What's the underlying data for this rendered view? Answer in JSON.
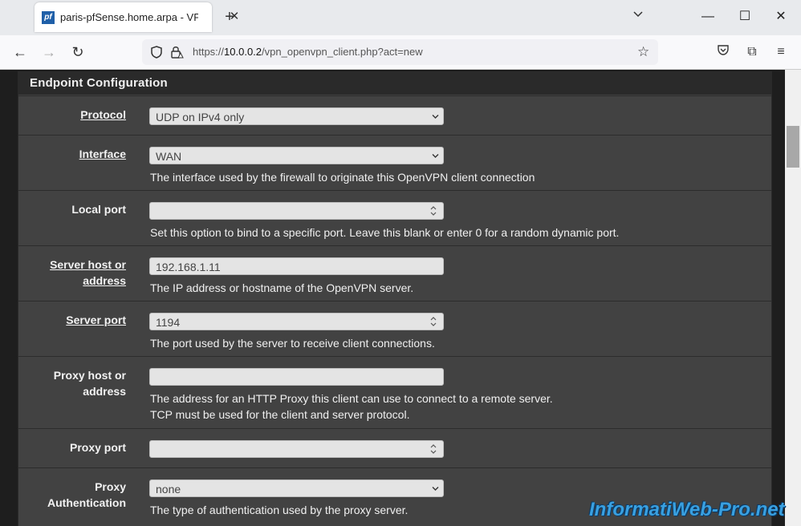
{
  "browser": {
    "tab_title": "paris-pfSense.home.arpa - VPN: OpenVPN: Clients",
    "favicon_text": "pf",
    "url_prefix": "https://",
    "url_host": "10.0.0.2",
    "url_path": "/vpn_openvpn_client.php?act=new"
  },
  "panel": {
    "title": "Endpoint Configuration"
  },
  "fields": {
    "protocol": {
      "label": "Protocol",
      "value": "UDP on IPv4 only"
    },
    "interface": {
      "label": "Interface",
      "value": "WAN",
      "help": "The interface used by the firewall to originate this OpenVPN client connection"
    },
    "local_port": {
      "label": "Local port",
      "value": "",
      "help": "Set this option to bind to a specific port. Leave this blank or enter 0 for a random dynamic port."
    },
    "server_host": {
      "label_line1": "Server host or",
      "label_line2": "address",
      "value": "192.168.1.11",
      "help": "The IP address or hostname of the OpenVPN server."
    },
    "server_port": {
      "label": "Server port",
      "value": "1194",
      "help": "The port used by the server to receive client connections."
    },
    "proxy_host": {
      "label_line1": "Proxy host or",
      "label_line2": "address",
      "value": "",
      "help_line1": "The address for an HTTP Proxy this client can use to connect to a remote server.",
      "help_line2": "TCP must be used for the client and server protocol."
    },
    "proxy_port": {
      "label": "Proxy port",
      "value": ""
    },
    "proxy_auth": {
      "label_line1": "Proxy",
      "label_line2": "Authentication",
      "value": "none",
      "help": "The type of authentication used by the proxy server."
    }
  },
  "watermark": "InformatiWeb-Pro.net"
}
